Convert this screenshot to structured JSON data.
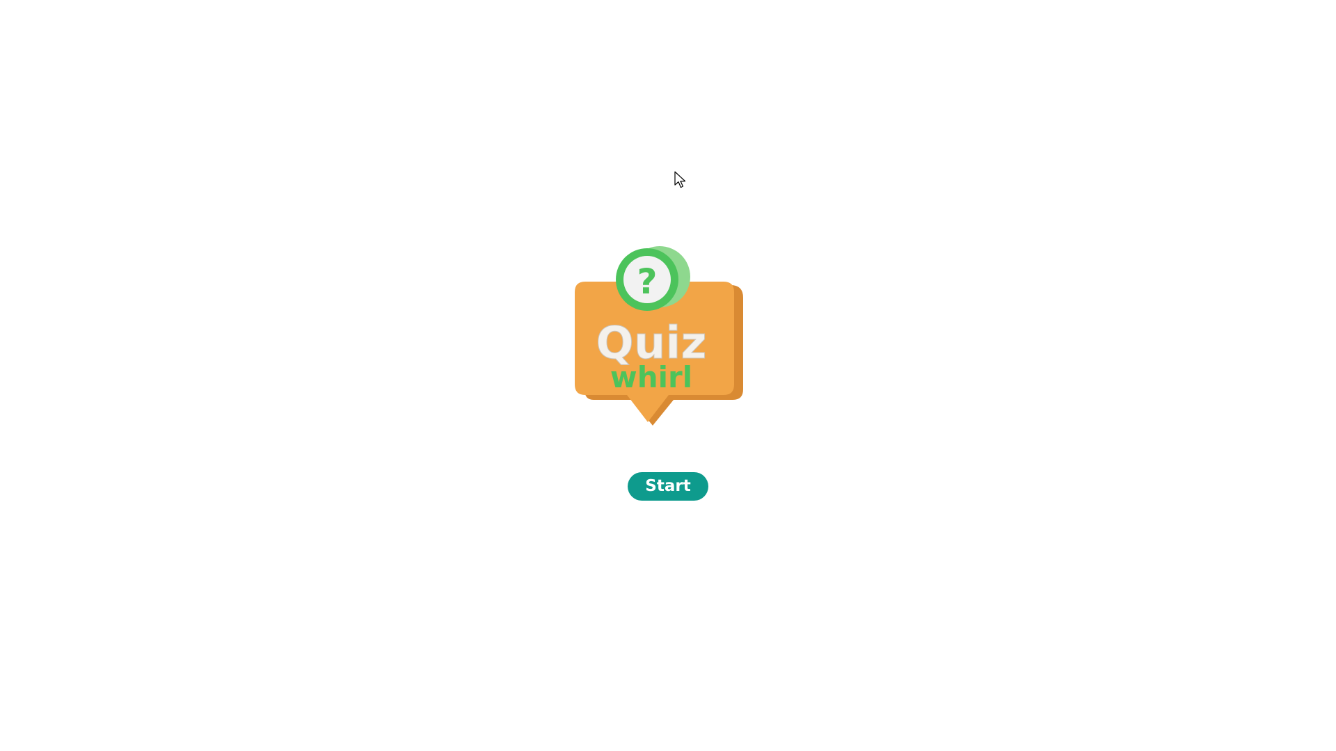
{
  "logo": {
    "title": "Quiz",
    "subtitle": "whirl",
    "badge_symbol": "?",
    "icon": "quiz-speech-bubble-icon",
    "colors": {
      "bubble": "#f2a547",
      "bubble_shade": "#d98a33",
      "badge": "#4cc35b",
      "badge_inner": "#f2f2f2",
      "title": "#f4f1ec",
      "subtitle": "#4cc35b"
    }
  },
  "start_button": {
    "label": "Start",
    "color": "#0e9b8d"
  },
  "cursor": {
    "icon": "mouse-pointer-icon"
  }
}
